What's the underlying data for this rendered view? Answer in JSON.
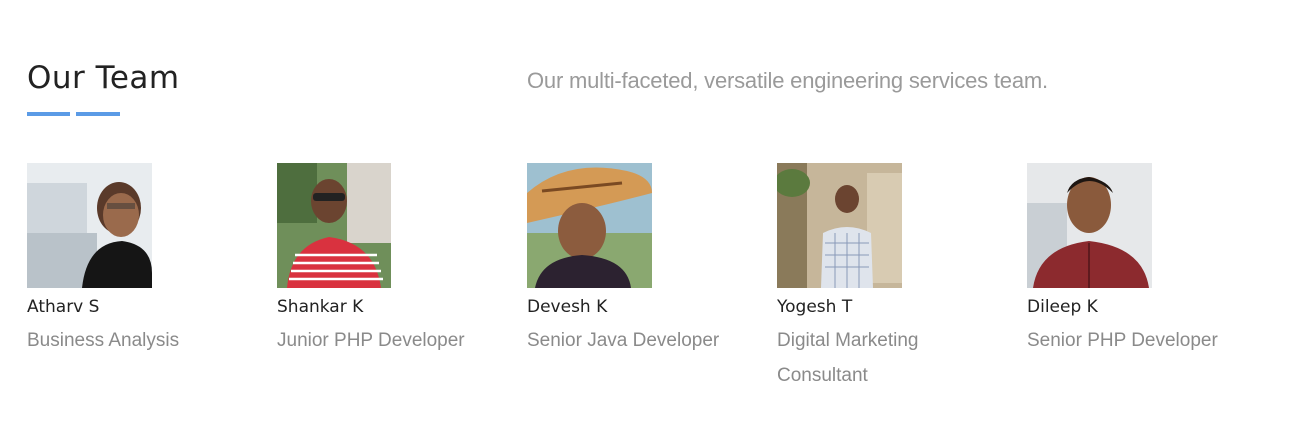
{
  "header": {
    "title": "Our Team",
    "tagline": "Our multi-faceted, versatile engineering services team.",
    "accent_color": "#5b9be6"
  },
  "members": [
    {
      "name": "Atharv S",
      "role": "Business Analysis",
      "avatar_icon": "person-photo"
    },
    {
      "name": "Shankar K",
      "role": "Junior PHP Developer",
      "avatar_icon": "person-photo"
    },
    {
      "name": "Devesh K",
      "role": "Senior Java Developer",
      "avatar_icon": "person-photo"
    },
    {
      "name": "Yogesh T",
      "role": "Digital Marketing Consultant",
      "avatar_icon": "person-photo"
    },
    {
      "name": "Dileep K",
      "role": "Senior PHP Developer",
      "avatar_icon": "person-photo"
    }
  ]
}
